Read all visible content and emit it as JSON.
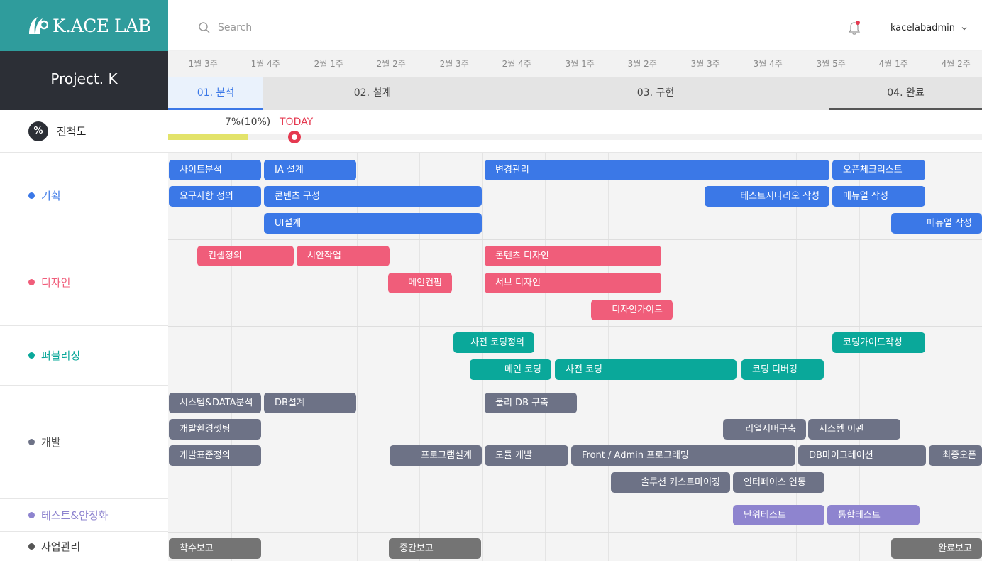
{
  "brand": {
    "name": "K.ACE LAB",
    "project": "Project. K"
  },
  "header": {
    "search_placeholder": "Search",
    "user": "kacelabadmin"
  },
  "weeks": [
    "1월 3주",
    "1월 4주",
    "2월 1주",
    "2월 2주",
    "2월 3주",
    "2월 4주",
    "3월 1주",
    "3월 2주",
    "3월 3주",
    "3월 4주",
    "3월 5주",
    "4월 1주",
    "4월 2주"
  ],
  "phases": [
    "01. 분석",
    "02. 설계",
    "03. 구현",
    "04. 완료"
  ],
  "progress": {
    "label": "진척도",
    "icon_text": "%",
    "value_text": "7%(10%)",
    "today_label": "TODAY",
    "progress_fraction": 0.07
  },
  "groups": [
    {
      "id": "plan",
      "label": "기획",
      "color": "#3b78e7"
    },
    {
      "id": "design",
      "label": "디자인",
      "color": "#f05d7a"
    },
    {
      "id": "pub",
      "label": "퍼블리싱",
      "color": "#0aa89a"
    },
    {
      "id": "dev",
      "label": "개발",
      "color": "#6d7286"
    },
    {
      "id": "test",
      "label": "테스트&안정화",
      "color": "#8e84cf"
    },
    {
      "id": "biz",
      "label": "사업관리",
      "color": "#555555"
    }
  ],
  "tasks": {
    "plan": [
      "사이트분석",
      "IA 설계",
      "변경관리",
      "오픈체크리스트",
      "요구사항 정의",
      "콘텐츠 구성",
      "테스트시나리오 작성",
      "매뉴얼 작성",
      "UI설계",
      "매뉴얼 작성"
    ],
    "design": [
      "컨셉정의",
      "시안작업",
      "콘텐츠 디자인",
      "메인컨펌",
      "서브 디자인",
      "디자인가이드"
    ],
    "pub": [
      "사전 코딩정의",
      "코딩가이드작성",
      "메인 코딩",
      "사전 코딩",
      "코딩 디버깅"
    ],
    "dev": [
      "시스템&DATA분석",
      "DB설계",
      "물리 DB 구축",
      "개발환경셋팅",
      "리얼서버구축",
      "시스템 이관",
      "개발표준정의",
      "프로그램설계",
      "모듈 개발",
      "Front / Admin 프로그래밍",
      "DB마이그레이션",
      "최종오픈",
      "솔루션 커스트마이징",
      "인터페이스 연동"
    ],
    "test": [
      "단위테스트",
      "통합테스트"
    ],
    "biz": [
      "착수보고",
      "중간보고",
      "완료보고"
    ]
  }
}
